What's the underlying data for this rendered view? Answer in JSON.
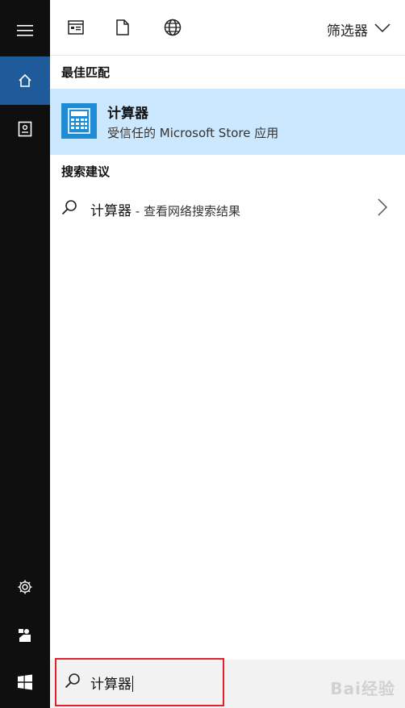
{
  "rail": {
    "items": [
      {
        "name": "menu-icon"
      },
      {
        "name": "home-icon",
        "active": true
      },
      {
        "name": "notebook-icon"
      },
      {
        "name": "settings-icon"
      },
      {
        "name": "feedback-icon"
      },
      {
        "name": "windows-start-icon"
      }
    ]
  },
  "topbar": {
    "icons": [
      "apps-icon",
      "documents-icon",
      "web-icon"
    ],
    "filter_label": "筛选器"
  },
  "best_match": {
    "heading": "最佳匹配",
    "app_name": "计算器",
    "app_sub": "受信任的 Microsoft Store 应用",
    "highlight_color": "#cce8ff",
    "icon_color": "#1e8bd4"
  },
  "suggestions": {
    "heading": "搜索建议",
    "items": [
      {
        "term": "计算器",
        "suffix": " - 查看网络搜索结果"
      }
    ]
  },
  "search": {
    "query": "计算器",
    "watermark": "Bai经验"
  },
  "colors": {
    "rail_bg": "#0f0f0f",
    "rail_active": "#1f5a9a",
    "search_border": "#e0222a"
  }
}
